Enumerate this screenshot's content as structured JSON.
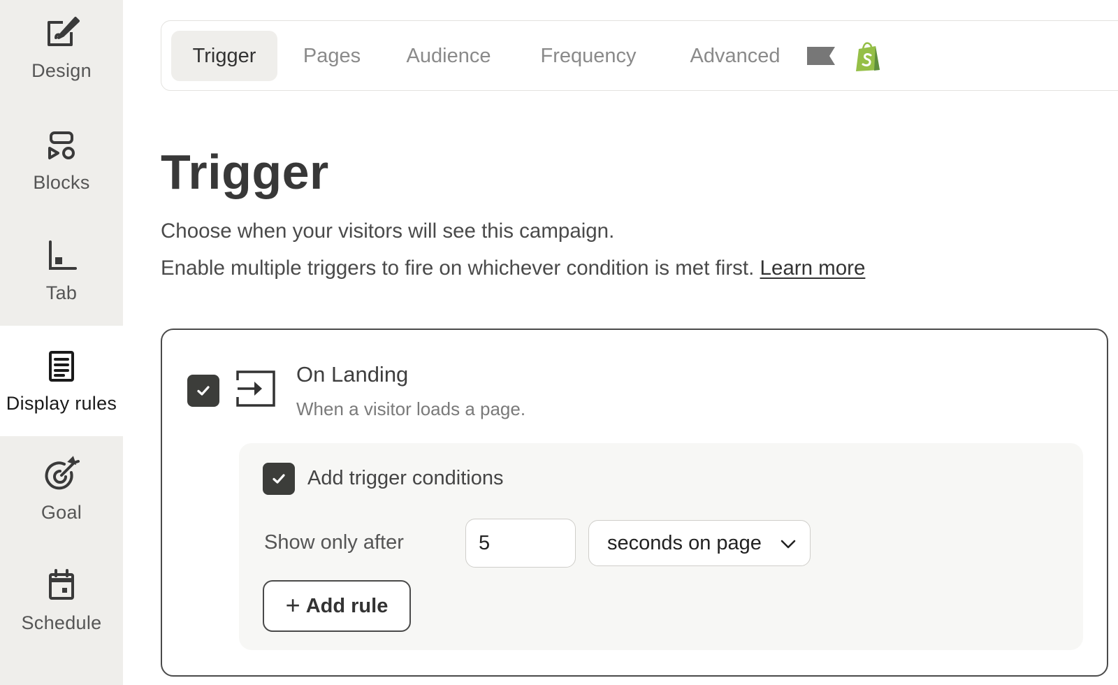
{
  "sidebar": {
    "items": [
      {
        "label": "Design",
        "icon": "paintbrush-icon",
        "active": false
      },
      {
        "label": "Blocks",
        "icon": "blocks-icon",
        "active": false
      },
      {
        "label": "Tab",
        "icon": "tab-icon",
        "active": false
      },
      {
        "label": "Display rules",
        "icon": "document-icon",
        "active": true
      },
      {
        "label": "Goal",
        "icon": "target-icon",
        "active": false
      },
      {
        "label": "Schedule",
        "icon": "calendar-icon",
        "active": false
      }
    ]
  },
  "tabs": {
    "items": [
      "Trigger",
      "Pages",
      "Audience",
      "Frequency",
      "Advanced"
    ],
    "active": "Trigger"
  },
  "page": {
    "title": "Trigger",
    "description_line1": "Choose when your visitors will see this campaign.",
    "description_line2": "Enable multiple triggers to fire on whichever condition is met first.",
    "learn_more": "Learn more"
  },
  "trigger": {
    "checked": true,
    "title": "On Landing",
    "subtitle": "When a visitor loads a page.",
    "conditions": {
      "checked": true,
      "label": "Add trigger conditions",
      "show_only_after": "Show only after",
      "value": "5",
      "unit": "seconds on page",
      "add_rule": "Add rule"
    }
  },
  "colors": {
    "sidebar_bg": "#efeeeb",
    "checkbox_fill": "#3c3d3a",
    "shopify_green": "#95bf47",
    "conditions_bg": "#f7f7f5"
  }
}
